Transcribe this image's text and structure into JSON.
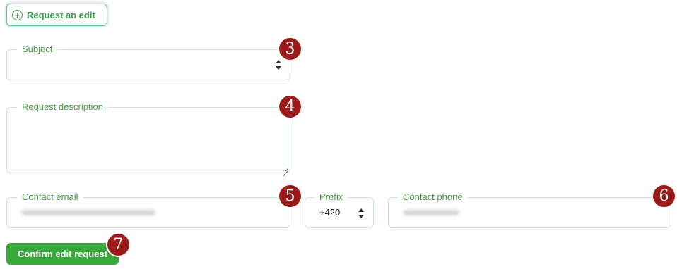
{
  "request_edit": {
    "label": "Request an edit",
    "icon": "plus-circle-icon"
  },
  "form": {
    "subject": {
      "label": "Subject",
      "value": "",
      "marker": "3"
    },
    "description": {
      "label": "Request description",
      "value": "",
      "marker": "4"
    },
    "email": {
      "label": "Contact email",
      "marker": "5"
    },
    "prefix": {
      "label": "Prefix",
      "value": "+420"
    },
    "phone": {
      "label": "Contact phone",
      "marker": "6"
    }
  },
  "confirm": {
    "label": "Confirm edit request",
    "marker": "7"
  },
  "colors": {
    "accent": "#38a83d",
    "label_green": "#4b9a4d",
    "marker": "#9b1b1b",
    "border": "#cfe3cf"
  }
}
